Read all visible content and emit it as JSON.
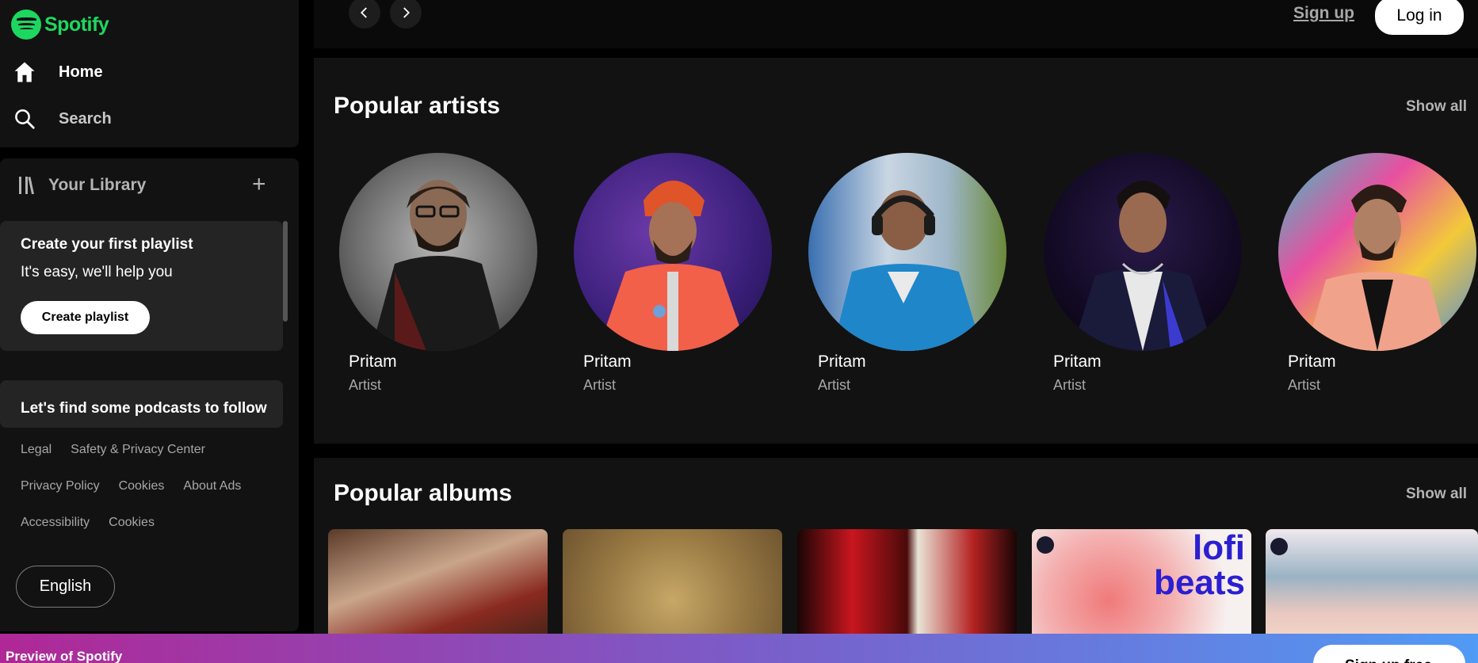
{
  "brand": {
    "name": "Spotify",
    "accent": "#1ed760"
  },
  "nav": {
    "home_label": "Home",
    "search_label": "Search"
  },
  "library": {
    "title": "Your Library",
    "promo1": {
      "title": "Create your first playlist",
      "subtitle": "It's easy, we'll help you",
      "button": "Create playlist"
    },
    "promo2": {
      "title": "Let's find some podcasts to follow"
    }
  },
  "footer": {
    "row1": [
      "Legal",
      "Safety & Privacy Center"
    ],
    "row2": [
      "Privacy Policy",
      "Cookies",
      "About Ads"
    ],
    "row3": [
      "Accessibility",
      "Cookies"
    ],
    "language_button": "English"
  },
  "topbar": {
    "back_icon": "chevron-left-icon",
    "forward_icon": "chevron-right-icon",
    "signup_label": "Sign up",
    "login_label": "Log in"
  },
  "sections": {
    "artists": {
      "title": "Popular artists",
      "show_all": "Show all",
      "items": [
        {
          "name": "Pritam",
          "role": "Artist"
        },
        {
          "name": "Pritam",
          "role": "Artist"
        },
        {
          "name": "Pritam",
          "role": "Artist"
        },
        {
          "name": "Pritam",
          "role": "Artist"
        },
        {
          "name": "Pritam",
          "role": "Artist"
        }
      ]
    },
    "albums": {
      "title": "Popular albums",
      "show_all": "Show all",
      "lofi_text_line1": "lofi",
      "lofi_text_line2": "beats"
    }
  },
  "banner": {
    "text": "Preview of Spotify",
    "button": "Sign up free"
  }
}
